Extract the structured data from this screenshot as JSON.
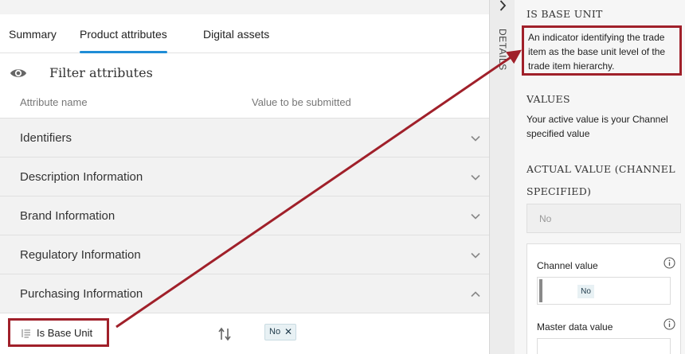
{
  "tabs": [
    "Summary",
    "Product attributes",
    "Digital assets"
  ],
  "filter": {
    "label": "Filter attributes"
  },
  "columns": {
    "name": "Attribute name",
    "value": "Value to be submitted"
  },
  "sections": [
    {
      "label": "Identifiers",
      "expanded": false
    },
    {
      "label": "Description Information",
      "expanded": false
    },
    {
      "label": "Brand Information",
      "expanded": false
    },
    {
      "label": "Regulatory Information",
      "expanded": false
    },
    {
      "label": "Purchasing Information",
      "expanded": true
    }
  ],
  "attribute_row": {
    "name": "Is Base Unit",
    "value_chip": "No"
  },
  "details_strip": {
    "label": "DETAILS"
  },
  "details": {
    "title": "IS BASE UNIT",
    "description": "An indicator identifying the trade item as the base unit level of the trade item hierarchy.",
    "values_heading": "VALUES",
    "values_text": "Your active value is your Channel specified value",
    "actual_heading_line1": "ACTUAL VALUE (CHANNEL",
    "actual_heading_line2": "SPECIFIED)",
    "actual_value": "No",
    "channel_value_label": "Channel value",
    "channel_value": "No",
    "master_value_label": "Master data value"
  },
  "colors": {
    "accent": "#1f8dd6",
    "highlight": "#a0202a"
  }
}
